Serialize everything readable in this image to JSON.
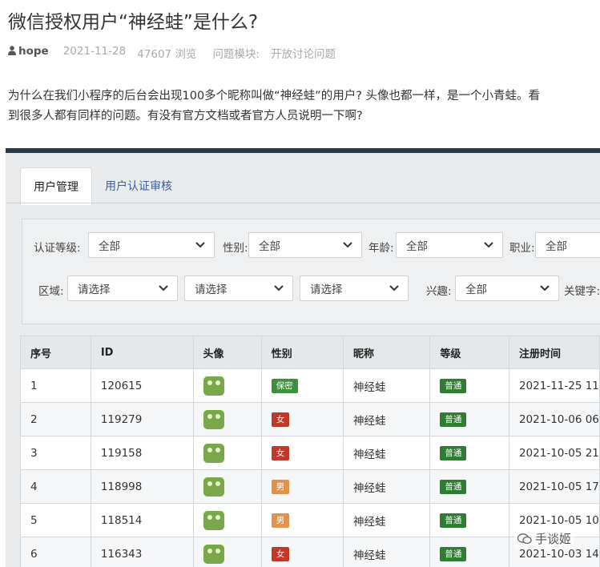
{
  "article": {
    "title": "微信授权用户“神经蛙”是什么?",
    "author": "hope",
    "date": "2021-11-28",
    "views_count": "47607",
    "views_label": "浏览",
    "module_label": "问题模块:",
    "module_value": "开放讨论问题",
    "question_line1": "为什么在我们小程序的后台会出现100多个昵称叫做“神经蛙”的用户? 头像也都一样，是一个小青蛙。看",
    "question_line2": "到很多人都有同样的问题。有没有官方文档或者官方人员说明一下啊?"
  },
  "screenshot": {
    "tabs": [
      {
        "label": "用户管理",
        "active": true
      },
      {
        "label": "用户认证审核",
        "active": false
      }
    ],
    "filters": {
      "cert_level_label": "认证等级:",
      "cert_level_value": "全部",
      "gender_label": "性别:",
      "gender_value": "全部",
      "age_label": "年龄:",
      "age_value": "全部",
      "job_label": "职业:",
      "job_value": "全部",
      "region_label": "区域:",
      "region_province": "请选择",
      "region_city": "请选择",
      "region_district": "请选择",
      "hobby_label": "兴趣:",
      "hobby_value": "全部",
      "keyword_label": "关键字:"
    },
    "table": {
      "headers": [
        "序号",
        "ID",
        "头像",
        "性别",
        "昵称",
        "等级",
        "注册时间"
      ],
      "rows": [
        {
          "no": "1",
          "id": "120615",
          "gender": "保密",
          "gender_color": "#3f8f3f",
          "nickname": "神经蛙",
          "level": "普通",
          "time": "2021-11-25 11"
        },
        {
          "no": "2",
          "id": "119279",
          "gender": "女",
          "gender_color": "#c0392b",
          "nickname": "神经蛙",
          "level": "普通",
          "time": "2021-10-06 06"
        },
        {
          "no": "3",
          "id": "119158",
          "gender": "女",
          "gender_color": "#c0392b",
          "nickname": "神经蛙",
          "level": "普通",
          "time": "2021-10-05 21"
        },
        {
          "no": "4",
          "id": "118998",
          "gender": "男",
          "gender_color": "#e0934a",
          "nickname": "神经蛙",
          "level": "普通",
          "time": "2021-10-05 17"
        },
        {
          "no": "5",
          "id": "118514",
          "gender": "男",
          "gender_color": "#e0934a",
          "nickname": "神经蛙",
          "level": "普通",
          "time": "2021-10-05 10"
        },
        {
          "no": "6",
          "id": "116343",
          "gender": "女",
          "gender_color": "#c0392b",
          "nickname": "神经蛙",
          "level": "普通",
          "time": "2021-10-03 14"
        }
      ]
    },
    "level_color": "#2e7d32"
  },
  "watermark": {
    "text": "手谈姬",
    "icon": "wechat-icon"
  }
}
